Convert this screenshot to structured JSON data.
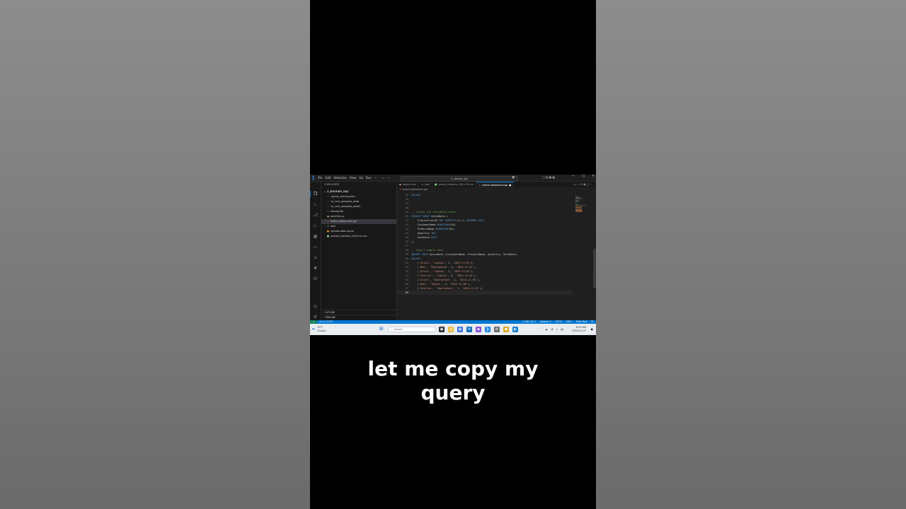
{
  "window": {
    "title_search": "2_docker_sql",
    "menu": [
      "File",
      "Edit",
      "Selection",
      "View",
      "Go",
      "Run",
      "···"
    ],
    "controls": [
      "—",
      "□",
      "✕"
    ]
  },
  "explorer": {
    "header": "EXPLORER",
    "root": "2_DOCKER_SQL",
    "items": [
      {
        "label": ".ipynb_checkpoints",
        "icon": "chevron-right-icon",
        "glyph": "›",
        "indent": 1
      },
      {
        "label": "ny_taxi_postgres_data",
        "icon": "chevron-right-icon",
        "glyph": "›",
        "indent": 1
      },
      {
        "label": "ny_taxi_postgres_dataC",
        "icon": "chevron-right-icon",
        "glyph": "›",
        "indent": 1
      },
      {
        "label": "Dockerfile",
        "icon": "docker-icon",
        "glyph": "⌂",
        "indent": 1
      },
      {
        "label": "pipeline.py",
        "icon": "python-icon",
        "glyph": "◆",
        "indent": 1
      },
      {
        "label": "select-statement.sql",
        "icon": "sql-file-icon",
        "glyph": "✕",
        "indent": 1,
        "selected": true
      },
      {
        "label": "test",
        "icon": "file-icon",
        "glyph": "≡",
        "indent": 1
      },
      {
        "label": "upload-data.ipynb",
        "icon": "notebook-icon",
        "glyph": "●",
        "indent": 1
      },
      {
        "label": "yellow_tripdata_2024-10.csv",
        "icon": "csv-file-icon",
        "glyph": "■",
        "indent": 1
      }
    ],
    "outline": "OUTLINE",
    "timeline": "TIMELINE"
  },
  "tabs": [
    {
      "label": "pipeline.py",
      "icon": "python-icon",
      "glyph": "◆",
      "color": "#e2c08d",
      "active": false
    },
    {
      "label": "test",
      "icon": "file-icon",
      "glyph": "≡",
      "color": "#9d9d9d",
      "active": false
    },
    {
      "label": "yellow_tripdata_2024-10.csv",
      "icon": "csv-file-icon",
      "glyph": "■",
      "color": "#89d185",
      "active": false
    },
    {
      "label": "select-statement.sql",
      "icon": "sql-file-icon",
      "glyph": "✕",
      "color": "#f14c4c",
      "active": true,
      "dirty": "●"
    }
  ],
  "breadcrumb": "select-statement.sql",
  "code_lines": [
    {
      "n": "45",
      "text": "VALUES"
    },
    {
      "n": "46",
      "text": ""
    },
    {
      "n": "47",
      "text": ""
    },
    {
      "n": "48",
      "text": ""
    },
    {
      "n": "49",
      "text": "-- Create the SalesData table"
    },
    {
      "n": "50",
      "text": "CREATE TABLE SalesData ("
    },
    {
      "n": "51",
      "text": "    TransactionID INT IDENTITY(1,1) PRIMARY KEY,"
    },
    {
      "n": "52",
      "text": "    CustomerName NVARCHAR(50),"
    },
    {
      "n": "53",
      "text": "    ProductName NVARCHAR(50),"
    },
    {
      "n": "54",
      "text": "    Quantity INT,"
    },
    {
      "n": "55",
      "text": "    SaleDate DATE"
    },
    {
      "n": "56",
      "text": ");"
    },
    {
      "n": "57",
      "text": ""
    },
    {
      "n": "58",
      "text": "-- Insert sample data"
    },
    {
      "n": "59",
      "text": "INSERT INTO SalesData (CustomerName, ProductName, Quantity, SaleDate)"
    },
    {
      "n": "60",
      "text": "VALUES"
    },
    {
      "n": "61",
      "text": "    ('Alice', 'Laptop', 1, '2024-12-01'),"
    },
    {
      "n": "62",
      "text": "    ('Bob', 'Smartphone', 2, '2024-12-02'),"
    },
    {
      "n": "63",
      "text": "    ('Alice', 'Laptop', 1, '2024-12-03'),"
    },
    {
      "n": "64",
      "text": "    ('Charlie', 'Tablet', 3, '2024-12-04'),"
    },
    {
      "n": "65",
      "text": "    ('Alice', 'Smartphone', 1, '2024-12-05'),"
    },
    {
      "n": "66",
      "text": "    ('Bob', 'Tablet', 2, '2024-12-06'),"
    },
    {
      "n": "67",
      "text": "    ('Charlie', 'Smartphone', 1, '2024-12-07');"
    },
    {
      "n": "68",
      "text": "",
      "current": true
    }
  ],
  "status": {
    "remote": "⌂",
    "left": "⊗ 0 ⚠ 0    ⚀ 0",
    "right": [
      "Ln 68, Col 1",
      "Spaces: 4",
      "UTF-8",
      "CRLF",
      "Plain Text",
      "☰"
    ]
  },
  "taskbar": {
    "weather_temp": "-8°C",
    "weather_text": "Cloudy",
    "search_placeholder": "Search",
    "clock_time": "8:33 AM",
    "clock_date": "2025-01-07",
    "apps": [
      {
        "icon": "terminal-icon",
        "glyph": "▣",
        "color": "#2b2b2b"
      },
      {
        "icon": "file-explorer-icon",
        "glyph": "▤",
        "color": "#e8b93a"
      },
      {
        "icon": "store-icon",
        "glyph": "▦",
        "color": "#3a6fd8"
      },
      {
        "icon": "outlook-icon",
        "glyph": "✉",
        "color": "#0f6cbd"
      },
      {
        "icon": "copilot-icon",
        "glyph": "◉",
        "color": "#8a4fd8"
      },
      {
        "icon": "vscode-icon",
        "glyph": "❯",
        "color": "#1e88e5"
      },
      {
        "icon": "settings-icon",
        "glyph": "⚙",
        "color": "#6b6b6b"
      },
      {
        "icon": "chrome-icon",
        "glyph": "●",
        "color": "#e0a21b"
      },
      {
        "icon": "edge-icon",
        "glyph": "◐",
        "color": "#1b7fd1"
      }
    ],
    "tray": [
      "˄",
      "☁",
      "◔",
      "♪",
      "▤"
    ]
  },
  "caption_line1": "let me copy my",
  "caption_line2": "query"
}
